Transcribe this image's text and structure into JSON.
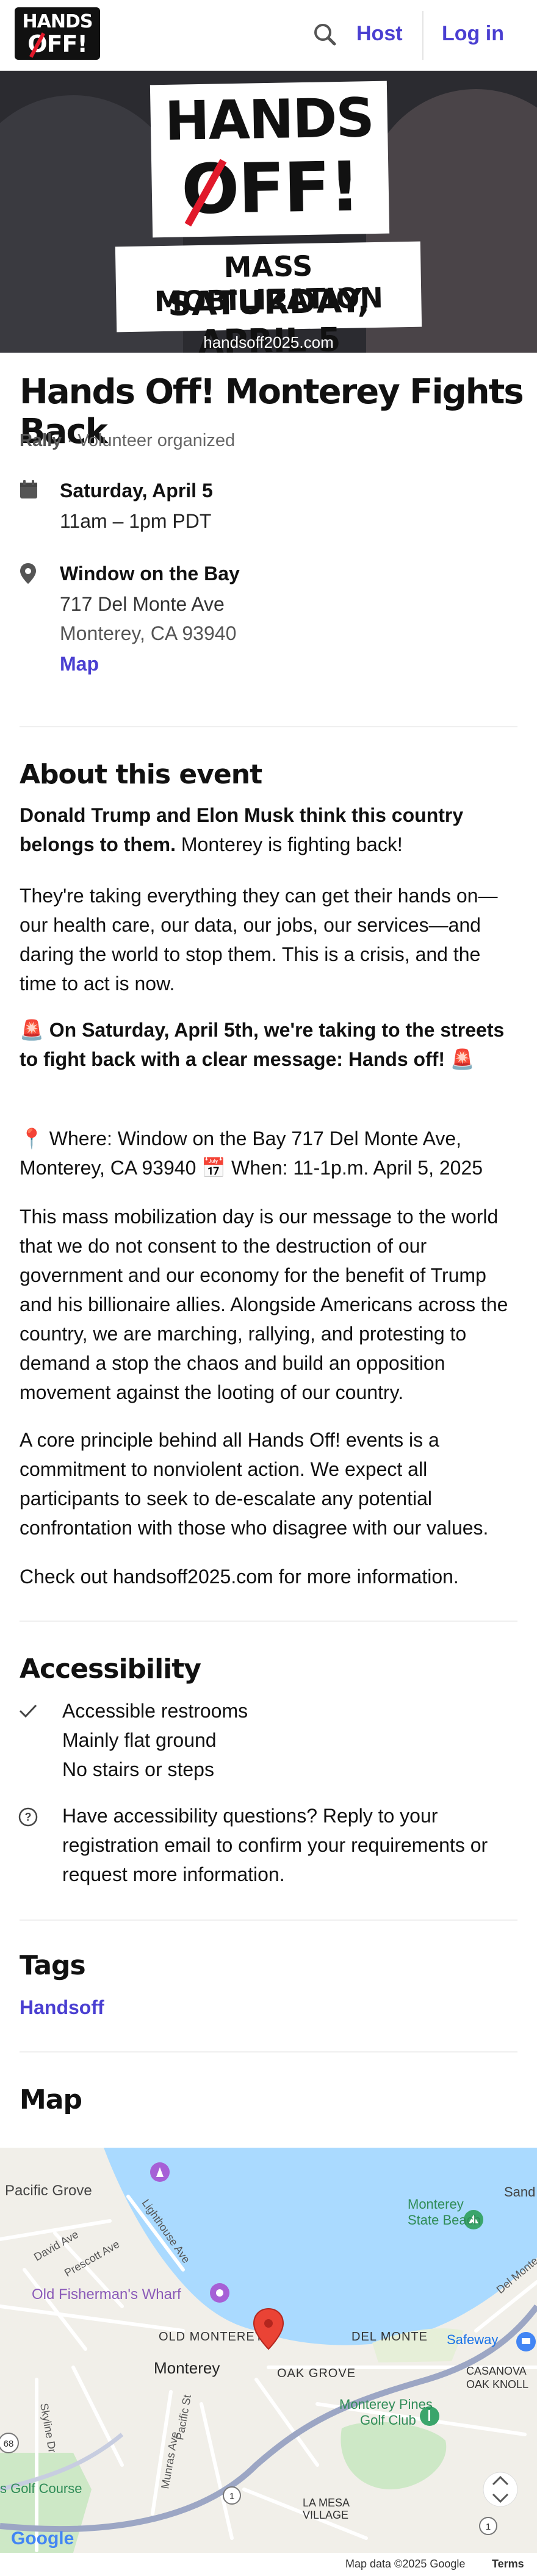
{
  "header": {
    "logo_line1": "HANDS",
    "logo_line2": "OFF!",
    "host_label": "Host",
    "login_label": "Log in"
  },
  "hero": {
    "poster_line1": "HANDS",
    "poster_line2": "OFF!",
    "banner_line1": "MASS MOBILIZATION",
    "banner_line2": "SATURDAY, APRIL 5",
    "url": "handsoff2025.com"
  },
  "event": {
    "title": "Hands Off! Monterey Fights Back",
    "category": "Rally",
    "organizer": "· Volunteer organized",
    "date": "Saturday, April 5",
    "time": "11am – 1pm PDT",
    "venue": "Window on the Bay",
    "address1": "717 Del Monte Ave",
    "address2": "Monterey, CA 93940",
    "map_link": "Map"
  },
  "about": {
    "heading": "About this event",
    "p1_bold": "Donald Trump and Elon Musk think this country belongs to them.",
    "p1_rest": " Monterey is fighting back!",
    "p2": "They're taking everything they can get their hands on—our health care, our data, our jobs, our services—and daring the world to stop them. This is a crisis, and the time to act is now.",
    "p3": "🚨 On Saturday, April 5th, we're taking to the streets to fight back with a clear message: Hands off! 🚨",
    "p4": "📍 Where: Window on the Bay 717 Del Monte Ave, Monterey, CA 93940 📅 When: 11-1p.m. April 5, 2025",
    "p5": "This mass mobilization day is our message to the world that we do not consent to the destruction of our government and our economy for the benefit of Trump and his billionaire allies. Alongside Americans across the country, we are marching, rallying, and protesting to demand a stop the chaos and build an opposition movement against the looting of our country.",
    "p6": "A core principle behind all Hands Off! events is a commitment to nonviolent action. We expect all participants to seek to de-escalate any potential confrontation with those who disagree with our values.",
    "p7": "Check out handsoff2025.com for more information."
  },
  "accessibility": {
    "heading": "Accessibility",
    "items": [
      "Accessible restrooms",
      "Mainly flat ground",
      "No stairs or steps"
    ],
    "question": "Have accessibility questions? Reply to your registration email to confirm your requirements or request more information."
  },
  "tags": {
    "heading": "Tags",
    "items": [
      "Handsoff"
    ]
  },
  "map": {
    "heading": "Map",
    "labels": {
      "pacific_grove": "Pacific Grove",
      "monterey_state_beach": "Monterey State Beach",
      "old_fishermans_wharf": "Old Fisherman's Wharf",
      "old_monterey": "OLD MONTEREY",
      "del_monte": "DEL MONTE",
      "monterey": "Monterey",
      "oak_grove": "OAK GROVE",
      "safeway": "Safeway",
      "casanova_oak_knoll": "CASANOVA OAK KNOLL",
      "monterey_pines_golf_club": "Monterey Pines Golf Club",
      "la_mesa_village": "LA MESA VILLAGE",
      "david_ave": "David Ave",
      "prescott_ave": "Prescott Ave",
      "lighthouse_ave": "Lighthouse Ave",
      "skyline_dr": "Skyline Dr",
      "munras_ave": "Munras Ave",
      "pacific_st": "Pacific St",
      "del_monte_road": "Del Monte",
      "golf_course": "s Golf Course",
      "sand": "Sand",
      "route_1": "1",
      "route_68": "68",
      "attribution": "Map data ©2025 Google",
      "terms": "Terms",
      "google": "Google"
    },
    "colors": {
      "water": "#aadaff",
      "land": "#f1efe9",
      "park": "#cde8c6",
      "road": "#ffffff",
      "highway": "#9ca6c4",
      "pin": "#ea4335"
    }
  }
}
